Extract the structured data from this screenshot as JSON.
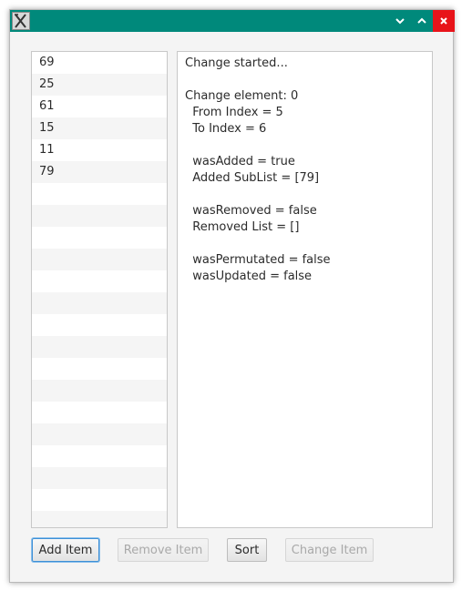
{
  "list": {
    "items": [
      "69",
      "25",
      "61",
      "15",
      "11",
      "79"
    ],
    "empty_rows": 16
  },
  "log": {
    "lines": [
      "Change started...",
      "",
      "Change element: 0",
      "  From Index = 5",
      "  To Index = 6",
      "",
      "  wasAdded = true",
      "  Added SubList = [79]",
      "",
      "  wasRemoved = false",
      "  Removed List = []",
      "",
      "  wasPermutated = false",
      "  wasUpdated = false"
    ]
  },
  "buttons": {
    "add_label": "Add Item",
    "remove_label": "Remove Item",
    "sort_label": "Sort",
    "change_label": "Change Item"
  },
  "titlebar": {
    "color": "#00897b",
    "close_color": "#e8141a",
    "icons": [
      "app-icon",
      "minimize-icon",
      "maximize-icon",
      "close-icon"
    ]
  }
}
